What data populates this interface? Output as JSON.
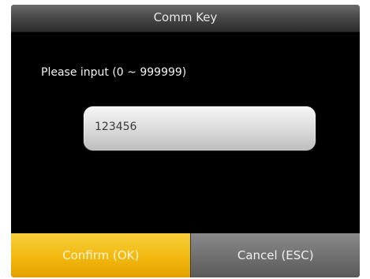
{
  "dialog": {
    "title": "Comm Key",
    "prompt": "Please input (0 ~ 999999)",
    "input_value": "123456"
  },
  "buttons": {
    "confirm_label": "Confirm (OK)",
    "cancel_label": "Cancel (ESC)"
  },
  "colors": {
    "confirm_accent": "#f2b80f",
    "cancel_bg": "#6f6f6f",
    "screen_bg": "#000000"
  }
}
